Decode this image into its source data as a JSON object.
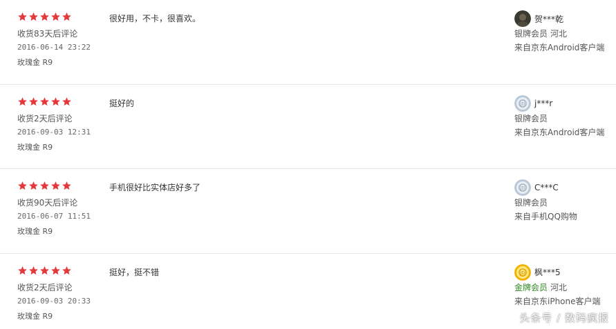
{
  "reviews": [
    {
      "stars": 5,
      "comment": "很好用，不卡，很喜欢。",
      "days_after": "收货83天后评论",
      "date": "2016-06-14 23:22",
      "variant": "玫瑰金 R9",
      "user": {
        "name": "贺***乾",
        "avatar": "photo-avatar-icon",
        "level": "银牌会员",
        "level_color": "#555555",
        "region": "河北",
        "source": "来自京东Android客户端"
      }
    },
    {
      "stars": 5,
      "comment": "挺好的",
      "days_after": "收货2天后评论",
      "date": "2016-09-03 12:31",
      "variant": "玫瑰金 R9",
      "user": {
        "name": "j***r",
        "avatar": "default-silver-avatar-icon",
        "level": "银牌会员",
        "level_color": "#555555",
        "region": "",
        "source": "来自京东Android客户端"
      }
    },
    {
      "stars": 5,
      "comment": "手机很好比实体店好多了",
      "days_after": "收货90天后评论",
      "date": "2016-06-07 11:51",
      "variant": "玫瑰金 R9",
      "user": {
        "name": "C***C",
        "avatar": "default-silver-avatar-icon",
        "level": "银牌会员",
        "level_color": "#555555",
        "region": "",
        "source": "来自手机QQ购物"
      }
    },
    {
      "stars": 5,
      "comment": "挺好，挺不错",
      "days_after": "收货2天后评论",
      "date": "2016-09-03 20:33",
      "variant": "玫瑰金 R9",
      "user": {
        "name": "枫***5",
        "avatar": "default-gold-avatar-icon",
        "level": "金牌会员",
        "level_color": "#2e8b20",
        "region": "河北",
        "source": "来自京东iPhone客户端"
      }
    }
  ],
  "watermark": "头条号 / 数码疯报",
  "colors": {
    "star": "#e4393c",
    "divider": "#e6e6e6",
    "gold_member": "#2e8b20"
  }
}
